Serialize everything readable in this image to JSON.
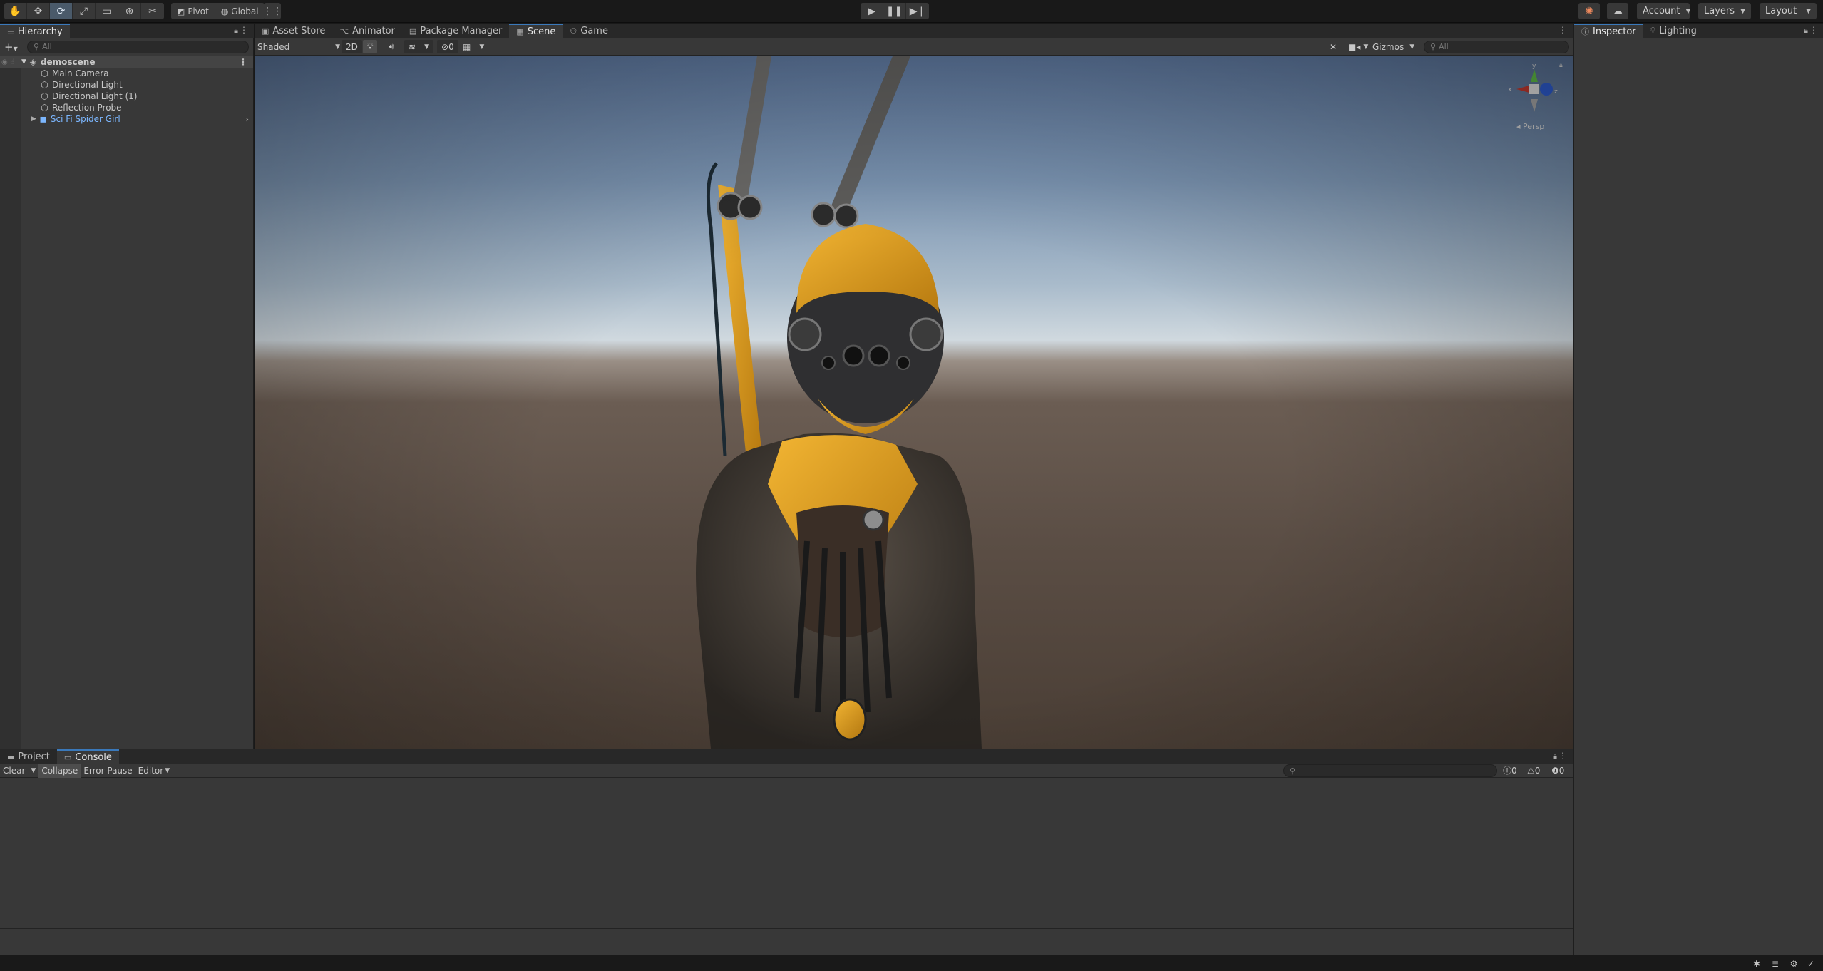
{
  "toolbar": {
    "tools": [
      "hand-icon",
      "move-icon",
      "rotate-icon",
      "scale-icon",
      "rect-icon",
      "transform-icon",
      "custom-tool-icon"
    ],
    "pivot_label": "Pivot",
    "global_label": "Global",
    "play_icon": "play-icon",
    "pause_icon": "pause-icon",
    "step_icon": "step-icon",
    "account_label": "Account",
    "layers_label": "Layers",
    "layout_label": "Layout"
  },
  "hierarchy": {
    "tab_label": "Hierarchy",
    "search_placeholder": "All",
    "scene_name": "demoscene",
    "items": [
      {
        "label": "Main Camera",
        "icon": "gameobject-icon"
      },
      {
        "label": "Directional Light",
        "icon": "gameobject-icon"
      },
      {
        "label": "Directional Light (1)",
        "icon": "gameobject-icon"
      },
      {
        "label": "Reflection Probe",
        "icon": "gameobject-icon"
      },
      {
        "label": "Sci Fi Spider Girl",
        "icon": "prefab-icon"
      }
    ]
  },
  "center_tabs": [
    {
      "label": "Asset Store",
      "icon": "store-icon"
    },
    {
      "label": "Animator",
      "icon": "animator-icon"
    },
    {
      "label": "Package Manager",
      "icon": "package-icon"
    },
    {
      "label": "Scene",
      "icon": "scene-icon",
      "active": true
    },
    {
      "label": "Game",
      "icon": "gamepad-icon"
    }
  ],
  "scene": {
    "shading_mode": "Shaded",
    "mode_2d": "2D",
    "hidden_count": "0",
    "gizmos_label": "Gizmos",
    "search_placeholder": "All",
    "projection_label": "Persp",
    "axis_x": "x",
    "axis_y": "y",
    "axis_z": "z"
  },
  "right_tabs": [
    {
      "label": "Inspector",
      "icon": "info-icon",
      "active": true
    },
    {
      "label": "Lighting",
      "icon": "bulb-icon"
    }
  ],
  "bottom_tabs": [
    {
      "label": "Project",
      "icon": "folder-icon"
    },
    {
      "label": "Console",
      "icon": "console-icon",
      "active": true
    }
  ],
  "console": {
    "clear_label": "Clear",
    "collapse_label": "Collapse",
    "error_pause_label": "Error Pause",
    "editor_label": "Editor",
    "log_count": "0",
    "warning_count": "0",
    "error_count": "0"
  },
  "colors": {
    "accent": "#3a79bb",
    "panel": "#383838",
    "prefab_text": "#7cb7ff"
  }
}
